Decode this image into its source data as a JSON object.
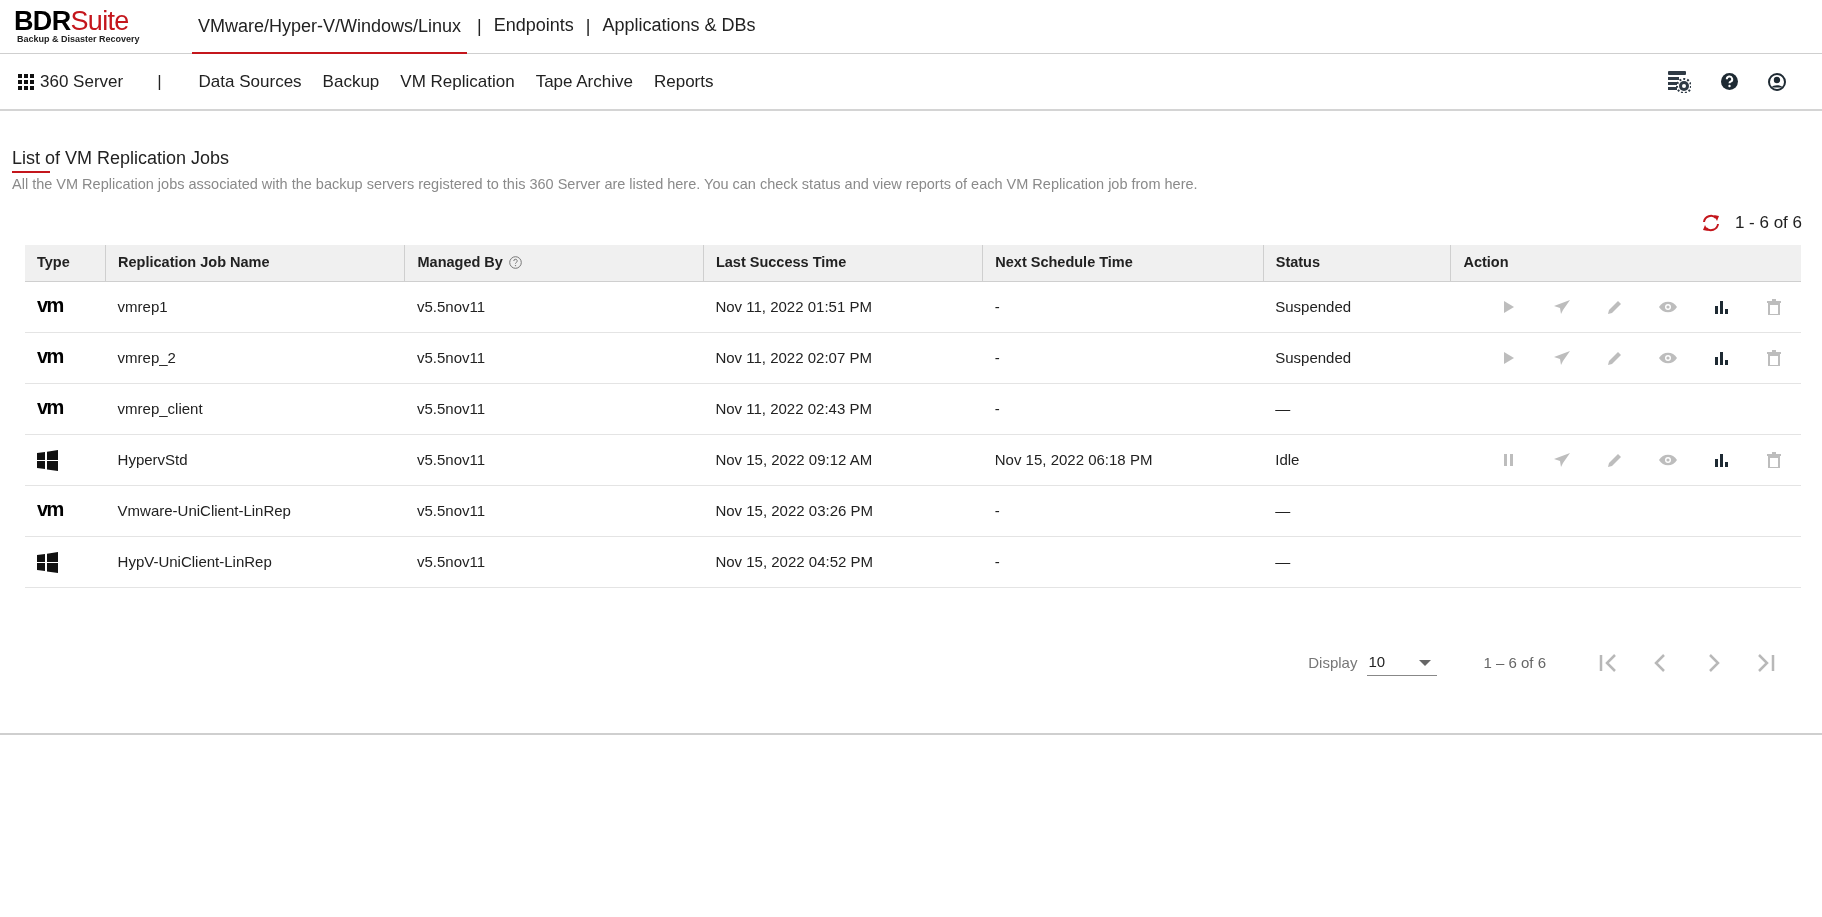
{
  "brand": {
    "name_dark": "BDR",
    "name_red": "Suite",
    "tagline": "Backup & Disaster Recovery"
  },
  "top_tabs": [
    {
      "label": "VMware/Hyper-V/Windows/Linux",
      "selected": true
    },
    {
      "label": "Endpoints",
      "selected": false
    },
    {
      "label": "Applications & DBs",
      "selected": false
    }
  ],
  "top_separator": "|",
  "server_menu": {
    "label": "360 Server",
    "separator": "|"
  },
  "nav": [
    {
      "label": "Data Sources"
    },
    {
      "label": "Backup"
    },
    {
      "label": "VM Replication"
    },
    {
      "label": "Tape Archive"
    },
    {
      "label": "Reports"
    }
  ],
  "page": {
    "title": "List of VM Replication Jobs",
    "description": "All the VM Replication jobs associated with the backup servers registered to this 360 Server are listed here. You can check status and view reports of each VM Replication job from here.",
    "count": "1 - 6 of 6"
  },
  "table": {
    "columns": [
      {
        "label": "Type"
      },
      {
        "label": "Replication Job Name"
      },
      {
        "label": "Managed By",
        "help": true
      },
      {
        "label": "Last Success Time"
      },
      {
        "label": "Next Schedule Time"
      },
      {
        "label": "Status"
      },
      {
        "label": "Action"
      }
    ],
    "rows": [
      {
        "type": {
          "kind": "vmware",
          "logo": "vm"
        },
        "name": "vmrep1",
        "managed_by": "v5.5nov11",
        "last_success": "Nov 11, 2022 01:51 PM",
        "next_schedule": "-",
        "status": "Suspended",
        "actions": [
          {
            "kind": "play",
            "disabled": true
          },
          {
            "kind": "send",
            "disabled": true
          },
          {
            "kind": "edit",
            "disabled": true
          },
          {
            "kind": "view",
            "disabled": true
          },
          {
            "kind": "report",
            "disabled": false
          },
          {
            "kind": "delete",
            "disabled": true
          }
        ]
      },
      {
        "type": {
          "kind": "vmware",
          "logo": "vm"
        },
        "name": "vmrep_2",
        "managed_by": "v5.5nov11",
        "last_success": "Nov 11, 2022 02:07 PM",
        "next_schedule": "-",
        "status": "Suspended",
        "actions": [
          {
            "kind": "play",
            "disabled": true
          },
          {
            "kind": "send",
            "disabled": true
          },
          {
            "kind": "edit",
            "disabled": true
          },
          {
            "kind": "view",
            "disabled": true
          },
          {
            "kind": "report",
            "disabled": false
          },
          {
            "kind": "delete",
            "disabled": true
          }
        ]
      },
      {
        "type": {
          "kind": "vmware",
          "logo": "vm"
        },
        "name": "vmrep_client",
        "managed_by": "v5.5nov11",
        "last_success": "Nov 11, 2022 02:43 PM",
        "next_schedule": "-",
        "status": "—"
      },
      {
        "type": {
          "kind": "windows"
        },
        "name": "HypervStd",
        "managed_by": "v5.5nov11",
        "last_success": "Nov 15, 2022 09:12 AM",
        "next_schedule": "Nov 15, 2022 06:18 PM",
        "status": "Idle",
        "actions": [
          {
            "kind": "pause",
            "disabled": true
          },
          {
            "kind": "send",
            "disabled": true
          },
          {
            "kind": "edit",
            "disabled": true
          },
          {
            "kind": "view",
            "disabled": true
          },
          {
            "kind": "report",
            "disabled": false
          },
          {
            "kind": "delete",
            "disabled": true
          }
        ]
      },
      {
        "type": {
          "kind": "vmware",
          "logo": "vm"
        },
        "name": "Vmware-UniClient-LinRep",
        "managed_by": "v5.5nov11",
        "last_success": "Nov 15, 2022 03:26 PM",
        "next_schedule": "-",
        "status": "—"
      },
      {
        "type": {
          "kind": "windows"
        },
        "name": "HypV-UniClient-LinRep",
        "managed_by": "v5.5nov11",
        "last_success": "Nov 15, 2022 04:52 PM",
        "next_schedule": "-",
        "status": "—"
      }
    ]
  },
  "pagination": {
    "display_label": "Display",
    "page_size": "10",
    "range": "1 – 6 of 6",
    "first_disabled": true,
    "prev_disabled": true,
    "next_disabled": true,
    "last_disabled": true
  }
}
